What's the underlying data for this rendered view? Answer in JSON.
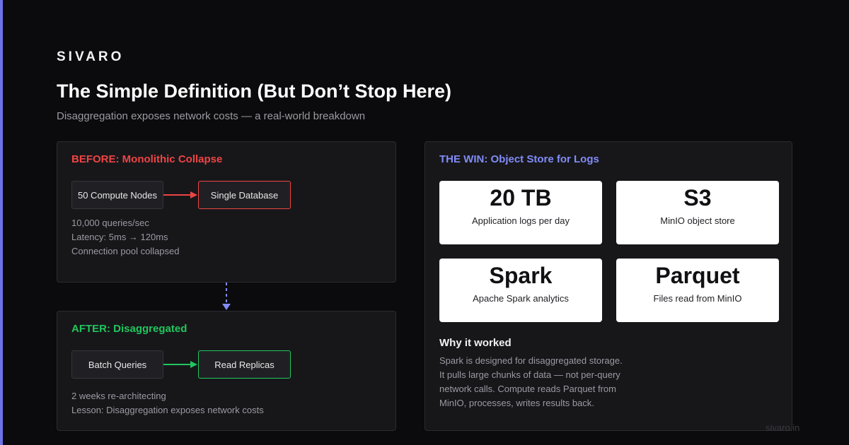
{
  "brand": "SIVARO",
  "title": "The Simple Definition (But Don’t Stop Here)",
  "subtitle": "Disaggregation exposes network costs — a real-world breakdown",
  "before": {
    "heading": "BEFORE: Monolithic Collapse",
    "source": "50 Compute Nodes",
    "target": "Single Database",
    "notes": [
      "10,000 queries/sec",
      "Latency: 5ms → 120ms",
      "Connection pool collapsed"
    ]
  },
  "after": {
    "heading": "AFTER: Disaggregated",
    "source": "Batch Queries",
    "target": "Read Replicas",
    "notes": [
      "2 weeks re-architecting",
      "Lesson: Disaggregation exposes network costs"
    ]
  },
  "win": {
    "heading": "THE WIN: Object Store for Logs",
    "stats": [
      {
        "value": "20 TB",
        "label": "Application logs per day"
      },
      {
        "value": "S3",
        "label": "MinIO object store"
      },
      {
        "value": "Spark",
        "label": "Apache Spark analytics"
      },
      {
        "value": "Parquet",
        "label": "Files read from MinIO"
      }
    ],
    "why_title": "Why it worked",
    "why_lines": [
      "Spark is designed for disaggregated storage.",
      "It pulls large chunks of data — not per-query",
      "network calls. Compute reads Parquet from",
      "MinIO, processes, writes results back."
    ]
  },
  "footer": "sivaro.in",
  "colors": {
    "accent": "#6c72e8",
    "before": "#ef4444",
    "after": "#22c55e",
    "win": "#818cf8"
  }
}
